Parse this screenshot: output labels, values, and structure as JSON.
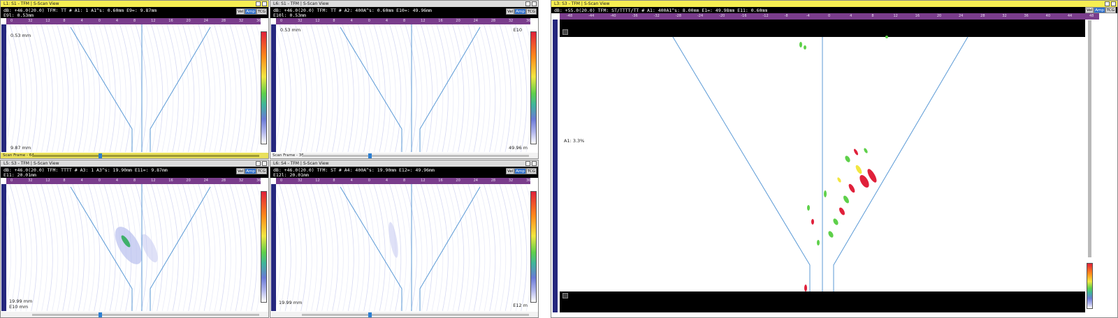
{
  "views": {
    "tl": {
      "title": "L1: S1 - TFM | S-Scan View",
      "info_line1": "dB: +46.0(20.0)  TFM: TT       # A1: 1   A1^s: 0.60mm   E9=: 9.87mm",
      "info_line2": "E9l: 0.53mm",
      "label_top": "0.53 mm",
      "label_bottom": "9.87 mm",
      "scan_frame": "Scan Frame - 64"
    },
    "tr": {
      "title": "L6: S1 - TFM | S-Scan View",
      "info_line1": "dB: +46.0(20.0)  TFM: TT       # A2: 400A^s: 0.60mm   E10=: 49.96mm",
      "info_line2": "E10l: 0.53mm",
      "label_top": "0.53 mm",
      "label_right": "E10",
      "label_bottom": "49.96 m",
      "scan_frame": "Scan Frame - 36"
    },
    "bl": {
      "title": "L5: S3 - TFM | S-Scan View",
      "info_line1": "dB: +46.0(20.0)  TFM: TTTT     # A3: 1    A3^s: 19.90mm  E11=: 9.87mm",
      "info_line2": "E11: 20.01mm",
      "label_bottom": "19.99 mm",
      "label_bottom2": "E10 mm"
    },
    "br": {
      "title": "L6: S4 - TFM | S-Scan View",
      "info_line1": "dB: +46.0(20.0)  TFM: ST       # A4: 400A^s: 19.90mm  E12=: 49.96mm",
      "info_line2": "E12l: 20.01mm",
      "label_bottom": "19.99 mm",
      "label_bottom_right": "E12 m"
    },
    "big": {
      "title": "L3: S3 - TFM | S-Scan View",
      "info_line1": "dB: +55.0(20.0)  TFM: ST/TTTT/TT  # A1: 400A1^s: 8.00mm   E1=: 49.98mm   E11: 0.60mm",
      "label_a1": "A1: 3.3%"
    }
  },
  "velamp": {
    "vel": "Vel",
    "amp": "Amp",
    "tcg": "TCG"
  },
  "ruler_ticks_small": [
    "0",
    "32",
    "12",
    "8",
    "4",
    "0",
    "4",
    "8",
    "12",
    "16",
    "20",
    "24",
    "28",
    "32",
    "36"
  ],
  "ruler_ticks_big": [
    "-48",
    "-44",
    "-40",
    "-36",
    "-32",
    "-28",
    "-24",
    "-20",
    "-16",
    "-12",
    "-8",
    "-4",
    "0",
    "4",
    "8",
    "12",
    "16",
    "20",
    "24",
    "28",
    "32",
    "36",
    "40",
    "44",
    "48"
  ],
  "colors": {
    "title_active": "#f6ee52",
    "ruler": "#7a3d8c",
    "ruler_left": "#26287e",
    "weld_line": "#5b9ad6",
    "amp_high": "#e0203a",
    "amp_mid": "#f2e640",
    "amp_low": "#5ed04a"
  }
}
